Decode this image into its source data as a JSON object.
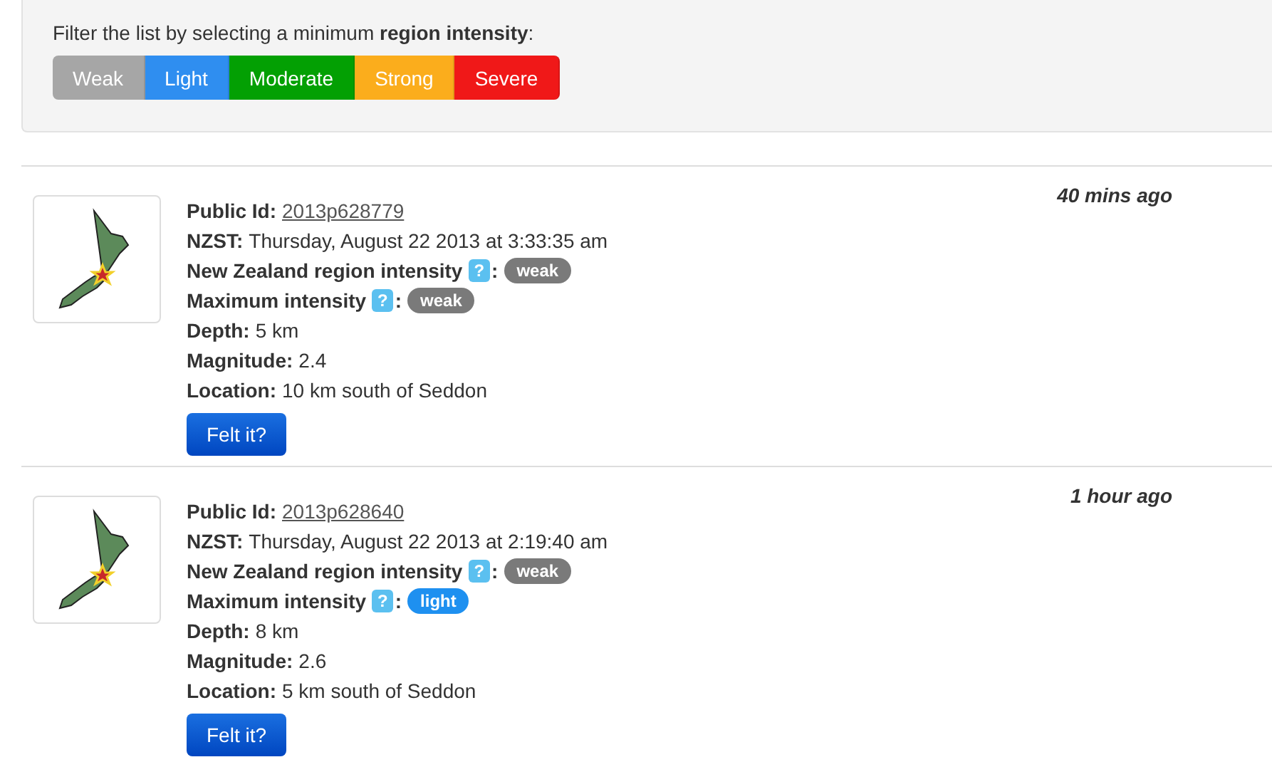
{
  "filter": {
    "prompt": "Filter the list by selecting a minimum **region intensity**:",
    "buttons": [
      {
        "label": "Weak",
        "color": "#a6a6a6"
      },
      {
        "label": "Light",
        "color": "#2f8ef0"
      },
      {
        "label": "Moderate",
        "color": "#03a003"
      },
      {
        "label": "Strong",
        "color": "#fbad1c"
      },
      {
        "label": "Severe",
        "color": "#f01818"
      }
    ]
  },
  "quakes": [
    {
      "time": "40 mins ago",
      "button": "Felt it?",
      "fields": [
        {
          "kind": "link",
          "label": "Public Id:",
          "value": "2013p628779"
        },
        {
          "kind": "text",
          "label": "NZST:",
          "value": "Thursday, August 22 2013 at 3:33:35 am"
        },
        {
          "kind": "intensity",
          "label": "New Zealand region intensity",
          "help": "?",
          "separator": ":",
          "value": "weak",
          "color": "#7a7a7a"
        },
        {
          "kind": "intensity",
          "label": "Maximum intensity",
          "help": "?",
          "separator": ":",
          "value": "weak",
          "color": "#7a7a7a"
        },
        {
          "kind": "text",
          "label": "Depth:",
          "value": "5 km"
        },
        {
          "kind": "text",
          "label": "Magnitude:",
          "value": "2.4"
        },
        {
          "kind": "text",
          "label": "Location:",
          "value": "10 km south of Seddon"
        }
      ]
    },
    {
      "time": "1 hour ago",
      "button": "Felt it?",
      "fields": [
        {
          "kind": "link",
          "label": "Public Id:",
          "value": "2013p628640"
        },
        {
          "kind": "text",
          "label": "NZST:",
          "value": "Thursday, August 22 2013 at 2:19:40 am"
        },
        {
          "kind": "intensity",
          "label": "New Zealand region intensity",
          "help": "?",
          "separator": ":",
          "value": "weak",
          "color": "#7a7a7a"
        },
        {
          "kind": "intensity",
          "label": "Maximum intensity",
          "help": "?",
          "separator": ":",
          "value": "light",
          "color": "#1e90f0"
        },
        {
          "kind": "text",
          "label": "Depth:",
          "value": "8 km"
        },
        {
          "kind": "text",
          "label": "Magnitude:",
          "value": "2.6"
        },
        {
          "kind": "text",
          "label": "Location:",
          "value": "5 km south of Seddon"
        }
      ]
    }
  ]
}
